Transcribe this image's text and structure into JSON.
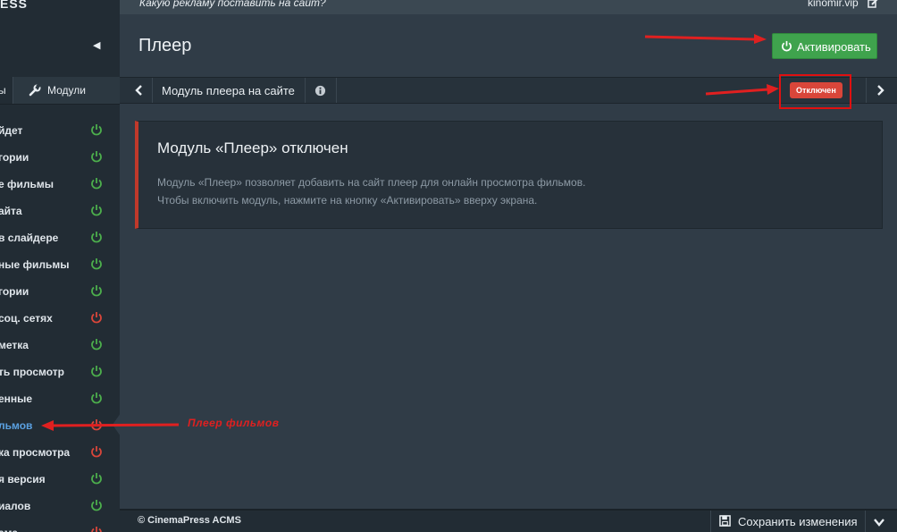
{
  "header": {
    "logo": "ESS",
    "question": "Какую рекламу поставить на сайт?",
    "site": "kinomir.vip"
  },
  "sidebar": {
    "tab_partial": "ы",
    "tab_modules": "Модули",
    "items": [
      {
        "label": "йдет",
        "status": "on"
      },
      {
        "label": "гории",
        "status": "on"
      },
      {
        "label": "е фильмы",
        "status": "on"
      },
      {
        "label": "айта",
        "status": "on"
      },
      {
        "label": "в слайдере",
        "status": "on"
      },
      {
        "label": "ные фильмы",
        "status": "on"
      },
      {
        "label": "гории",
        "status": "on"
      },
      {
        "label": "соц. сетях",
        "status": "off"
      },
      {
        "label": "метка",
        "status": "on"
      },
      {
        "label": "ть просмотр",
        "status": "on"
      },
      {
        "label": "енные",
        "status": "on"
      },
      {
        "label": "льмов",
        "status": "off",
        "active": true
      },
      {
        "label": "ка просмотра",
        "status": "off"
      },
      {
        "label": "я версия",
        "status": "on"
      },
      {
        "label": "иалов",
        "status": "on"
      },
      {
        "label": "ама",
        "status": "off"
      }
    ]
  },
  "main": {
    "title": "Плеер",
    "activate_label": "Активировать",
    "subbar": {
      "module_title": "Модуль плеера на сайте",
      "status_badge": "Отключен"
    },
    "notice": {
      "heading": "Модуль «Плеер» отключен",
      "line1": "Модуль «Плеер» позволяет добавить на сайт плеер для онлайн просмотра фильмов.",
      "line2": "Чтобы включить модуль, нажмите на кнопку «Активировать» вверху экрана."
    }
  },
  "footer": {
    "copyright": "© CinemaPress ACMS",
    "save_label": "Сохранить изменения"
  },
  "annotation": {
    "text": "Плеер фильмов"
  },
  "colors": {
    "on": "#4cae4c",
    "off": "#d9463a",
    "accent": "#5aa0e0",
    "annotation": "#e02020"
  }
}
